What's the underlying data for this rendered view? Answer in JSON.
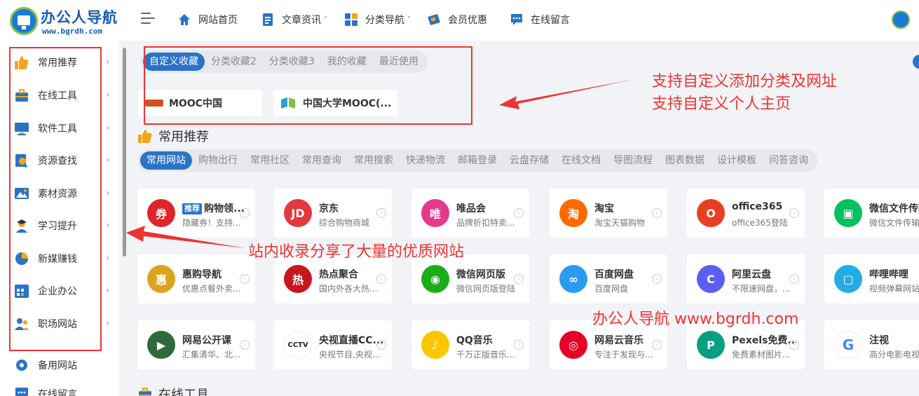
{
  "header": {
    "logo_title": "办公人导航",
    "logo_url": "www.bgrdh.com",
    "nav": [
      {
        "label": "网站首页",
        "icon": "home-icon"
      },
      {
        "label": "文章资讯",
        "icon": "document-icon",
        "caret": "˅"
      },
      {
        "label": "分类导航",
        "icon": "grid-icon",
        "caret": "˅"
      },
      {
        "label": "会员优惠",
        "icon": "ticket-icon"
      },
      {
        "label": "在线留言",
        "icon": "chat-icon"
      }
    ]
  },
  "sidebar": {
    "items": [
      {
        "label": "常用推荐",
        "icon": "thumbs-up-icon"
      },
      {
        "label": "在线工具",
        "icon": "toolbox-icon"
      },
      {
        "label": "软件工具",
        "icon": "monitor-icon"
      },
      {
        "label": "资源查找",
        "icon": "search-doc-icon"
      },
      {
        "label": "素材资源",
        "icon": "image-icon"
      },
      {
        "label": "学习提升",
        "icon": "student-icon"
      },
      {
        "label": "新媒赚钱",
        "icon": "pie-chart-icon"
      },
      {
        "label": "企业办公",
        "icon": "calendar-icon"
      },
      {
        "label": "职场网站",
        "icon": "users-icon"
      },
      {
        "label": "备用网站",
        "icon": "gear-icon"
      },
      {
        "label": "在线留言",
        "icon": "chat-icon"
      }
    ],
    "chevron": "›"
  },
  "favorites": {
    "tabs": [
      "自定义收藏",
      "分类收藏2",
      "分类收藏3",
      "我的收藏",
      "最近使用"
    ],
    "active": 0,
    "bookmarks": [
      {
        "label": "MOOC中国"
      },
      {
        "label": "中国大学MOOC(..."
      }
    ]
  },
  "section_recommend": {
    "title": "常用推荐",
    "tabs": [
      "常用网站",
      "购物出行",
      "常用社区",
      "常用查询",
      "常用搜索",
      "快递物流",
      "邮箱登录",
      "云盘存储",
      "在线文档",
      "导图流程",
      "图表数据",
      "设计模板",
      "问答咨询"
    ],
    "active": 0
  },
  "cards": [
    {
      "title": "购物领...",
      "tag": "推荐",
      "desc": "隐藏券！支持...",
      "logo_text": "券",
      "color": "#e0242b"
    },
    {
      "title": "京东",
      "desc": "综合购物商城",
      "logo_text": "JD",
      "color": "#e4393c"
    },
    {
      "title": "唯品会",
      "desc": "品牌折扣特卖...",
      "logo_text": "唯",
      "color": "#e5398a"
    },
    {
      "title": "淘宝",
      "desc": "淘宝天猫购物",
      "logo_text": "淘",
      "color": "#ff6a00"
    },
    {
      "title": "office365",
      "desc": "office365登陆",
      "logo_text": "O",
      "color": "#ea3e23"
    },
    {
      "title": "微信文件传输",
      "desc": "微信文件传输",
      "logo_text": "▣",
      "color": "#07c160"
    },
    {
      "title": "惠购导航",
      "desc": "优惠点餐外卖...",
      "logo_text": "惠",
      "color": "#d9a521"
    },
    {
      "title": "热点聚合",
      "desc": "国内外各大热...",
      "logo_text": "热",
      "color": "#c8161d"
    },
    {
      "title": "微信网页版",
      "desc": "微信网页版登陆",
      "logo_text": "◉",
      "color": "#1aad19"
    },
    {
      "title": "百度网盘",
      "desc": "百度网盘",
      "logo_text": "∞",
      "color": "#2b9af3"
    },
    {
      "title": "阿里云盘",
      "desc": "不限速网盘，...",
      "logo_text": "C",
      "color": "#5b5ff0"
    },
    {
      "title": "哔哩哔哩",
      "desc": "视频弹幕网站",
      "logo_text": "▢",
      "color": "#23ade5"
    },
    {
      "title": "网易公开课",
      "desc": "汇集清华、北...",
      "logo_text": "▶",
      "color": "#2f6a3a"
    },
    {
      "title": "央视直播CC...",
      "desc": "央视节目,央视...",
      "logo_text": "CCTV",
      "color": "#ffffff"
    },
    {
      "title": "QQ音乐",
      "desc": "千万正版音乐...",
      "logo_text": "♪",
      "color": "#f9c700"
    },
    {
      "title": "网易云音乐",
      "desc": "专注于发现与...",
      "logo_text": "◎",
      "color": "#e60026"
    },
    {
      "title": "Pexels免费...",
      "desc": "免费素材图片...",
      "logo_text": "P",
      "color": "#05a081"
    },
    {
      "title": "注视",
      "desc": "高分电影电视",
      "logo_text": "G",
      "color": "#ffffff"
    }
  ],
  "section_tools": {
    "title": "在线工具"
  },
  "annotations": {
    "favorites_line1": "支持自定义添加分类及网址",
    "favorites_line2": "支持自定义个人主页",
    "sidebar_note": "站内收录分享了大量的优质网站",
    "watermark": "办公人导航  www.bgrdh.com"
  },
  "colors": {
    "accent": "#2a73c6",
    "annotation_red": "#e33333"
  }
}
